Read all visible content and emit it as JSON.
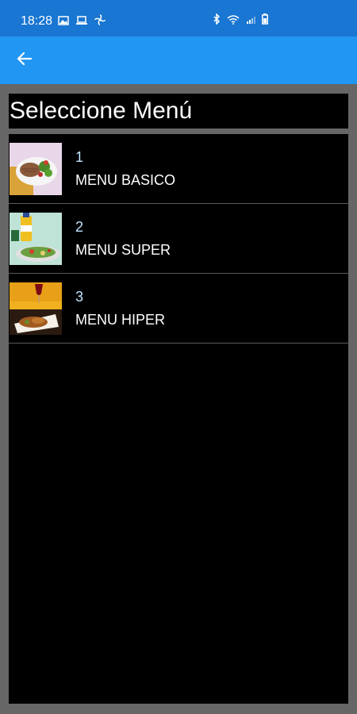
{
  "status_bar": {
    "time": "18:28",
    "left_icons": [
      "image-icon",
      "laptop-icon",
      "fan-icon"
    ],
    "right_icons": [
      "bluetooth-icon",
      "wifi-icon",
      "signal-icon",
      "battery-icon"
    ]
  },
  "app_bar": {
    "back_icon": "arrow-left-icon"
  },
  "page": {
    "title": "Seleccione Menú"
  },
  "menu": {
    "items": [
      {
        "number": "1",
        "name": "MENU BASICO",
        "image": "salad-burger-plate"
      },
      {
        "number": "2",
        "name": "MENU SUPER",
        "image": "drink-and-salad-plate"
      },
      {
        "number": "3",
        "name": "MENU HIPER",
        "image": "wine-and-meat-plate"
      }
    ]
  },
  "colors": {
    "status_bar": "#1976d2",
    "app_bar": "#2196f3",
    "background": "#666666",
    "panel": "#000000",
    "number_text": "#bfe3ff"
  }
}
